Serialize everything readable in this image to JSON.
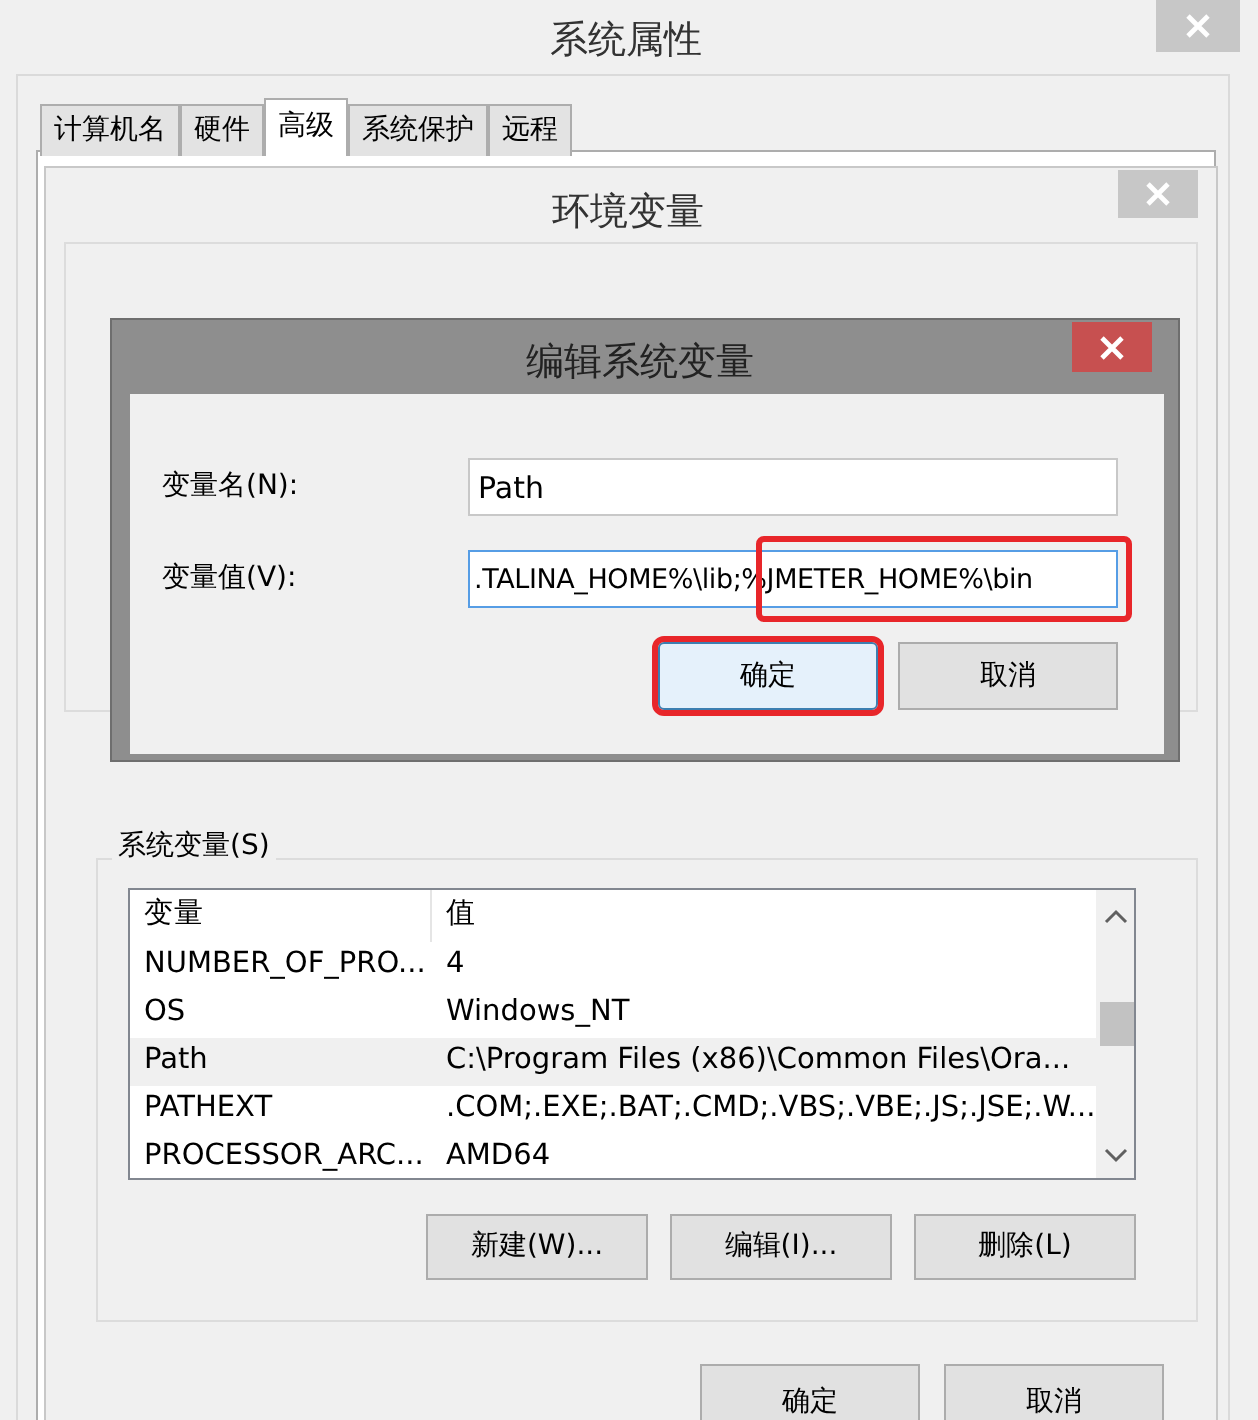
{
  "system_properties": {
    "title": "系统属性",
    "tabs": [
      {
        "label": "计算机名",
        "selected": false
      },
      {
        "label": "硬件",
        "selected": false
      },
      {
        "label": "高级",
        "selected": true
      },
      {
        "label": "系统保护",
        "selected": false
      },
      {
        "label": "远程",
        "selected": false
      }
    ]
  },
  "environment_variables": {
    "title": "环境变量",
    "system_variables": {
      "label": "系统变量(S)",
      "columns": [
        "变量",
        "值"
      ],
      "rows": [
        {
          "name": "NUMBER_OF_PRO...",
          "value": "4",
          "selected": false
        },
        {
          "name": "OS",
          "value": "Windows_NT",
          "selected": false
        },
        {
          "name": "Path",
          "value": "C:\\Program Files (x86)\\Common Files\\Ora...",
          "selected": true
        },
        {
          "name": "PATHEXT",
          "value": ".COM;.EXE;.BAT;.CMD;.VBS;.VBE;.JS;.JSE;.W...",
          "selected": false
        },
        {
          "name": "PROCESSOR_ARC...",
          "value": "AMD64",
          "selected": false
        }
      ],
      "buttons": [
        "新建(W)...",
        "编辑(I)...",
        "删除(L)"
      ]
    },
    "buttons": [
      "确定",
      "取消"
    ]
  },
  "edit_dialog": {
    "title": "编辑系统变量",
    "name_label": "变量名(N):",
    "name_value": "Path",
    "value_label": "变量值(V):",
    "value_value": ".TALINA_HOME%\\lib;%JMETER_HOME%\\bin",
    "value_highlighted": true,
    "buttons": [
      {
        "label": "确定",
        "default": true,
        "highlighted": true
      },
      {
        "label": "取消",
        "default": false,
        "highlighted": false
      }
    ]
  }
}
